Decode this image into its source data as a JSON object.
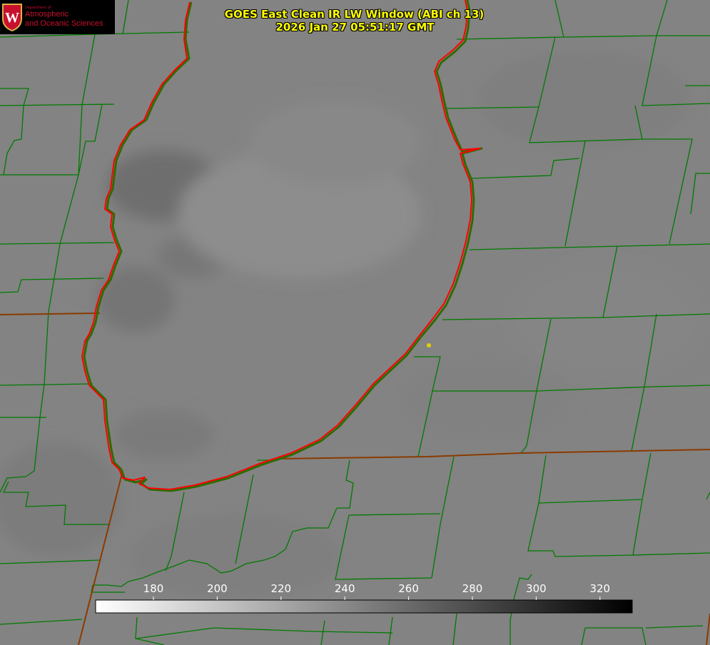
{
  "header": {
    "title": "GOES East Clean IR LW Window (ABI ch 13)",
    "timestamp": "2026 Jan 27 05:51:17 GMT"
  },
  "logo": {
    "department": "Department of",
    "line1": "Atmospheric",
    "line2": "and Oceanic Sciences",
    "emblem_letter": "W"
  },
  "colorbar": {
    "ticks": [
      "180",
      "200",
      "220",
      "240",
      "260",
      "280",
      "300",
      "320"
    ],
    "gradient_start": "#ffffff",
    "gradient_end": "#000000"
  },
  "colors": {
    "background_gray": "#808080",
    "county_border": "#007a00",
    "state_border": "#8b3a00",
    "lake_outline": "#ff0000",
    "title_text": "#ffff00",
    "logo_red": "#c8102e",
    "marker_dot": "#e0d000"
  }
}
